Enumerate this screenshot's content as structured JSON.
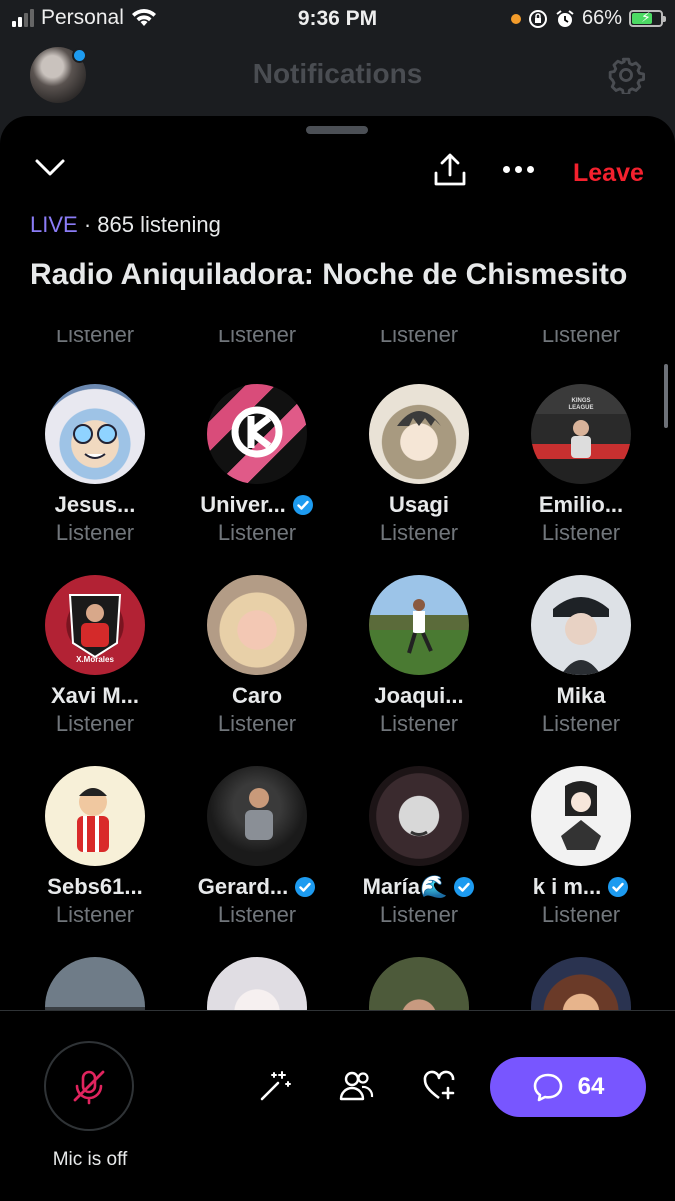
{
  "status_bar": {
    "carrier": "Personal",
    "time": "9:36 PM",
    "battery": "66%",
    "battery_level": 0.66,
    "icons": [
      "wifi-icon",
      "privacy-dot",
      "orientation-lock-icon",
      "alarm-icon",
      "battery-charging-icon"
    ]
  },
  "background_header": {
    "title": "Notifications",
    "icons": [
      "avatar",
      "gear-icon"
    ]
  },
  "space": {
    "live_label": "LIVE",
    "listening": "· 865 listening",
    "title": "Radio Aniquiladora: Noche de Chismesito",
    "actions": {
      "leave": "Leave",
      "icons": [
        "chevron-down-icon",
        "share-icon",
        "more-icon"
      ]
    }
  },
  "row_above": [
    "Listener",
    "Listener",
    "Listener",
    "Listener"
  ],
  "participants": [
    {
      "name": "Jesus...",
      "role": "Listener",
      "verified": false
    },
    {
      "name": "Univer...",
      "role": "Listener",
      "verified": true
    },
    {
      "name": "Usagi",
      "role": "Listener",
      "verified": false
    },
    {
      "name": "Emilio...",
      "role": "Listener",
      "verified": false
    },
    {
      "name": "Xavi M...",
      "role": "Listener",
      "verified": false
    },
    {
      "name": "Caro",
      "role": "Listener",
      "verified": false
    },
    {
      "name": "Joaqui...",
      "role": "Listener",
      "verified": false
    },
    {
      "name": "Mika",
      "role": "Listener",
      "verified": false
    },
    {
      "name": "Sebs61...",
      "role": "Listener",
      "verified": false
    },
    {
      "name": "Gerard...",
      "role": "Listener",
      "verified": true
    },
    {
      "name": "María🌊",
      "role": "Listener",
      "verified": true
    },
    {
      "name": "k i m...",
      "role": "Listener",
      "verified": true
    }
  ],
  "avatar_text": {
    "xavi": "X.Morales",
    "emilio": "KINGS LEAGUE"
  },
  "bottom_bar": {
    "mic_label": "Mic is off",
    "chat_count": "64",
    "icons": [
      "mic-off-icon",
      "sparkle-wand-icon",
      "people-icon",
      "heart-plus-icon",
      "chat-bubble-icon"
    ]
  },
  "colors": {
    "accent": "#7856ff",
    "leave": "#f4212e",
    "live": "#8b7cf6",
    "verified": "#1d9bf0"
  }
}
